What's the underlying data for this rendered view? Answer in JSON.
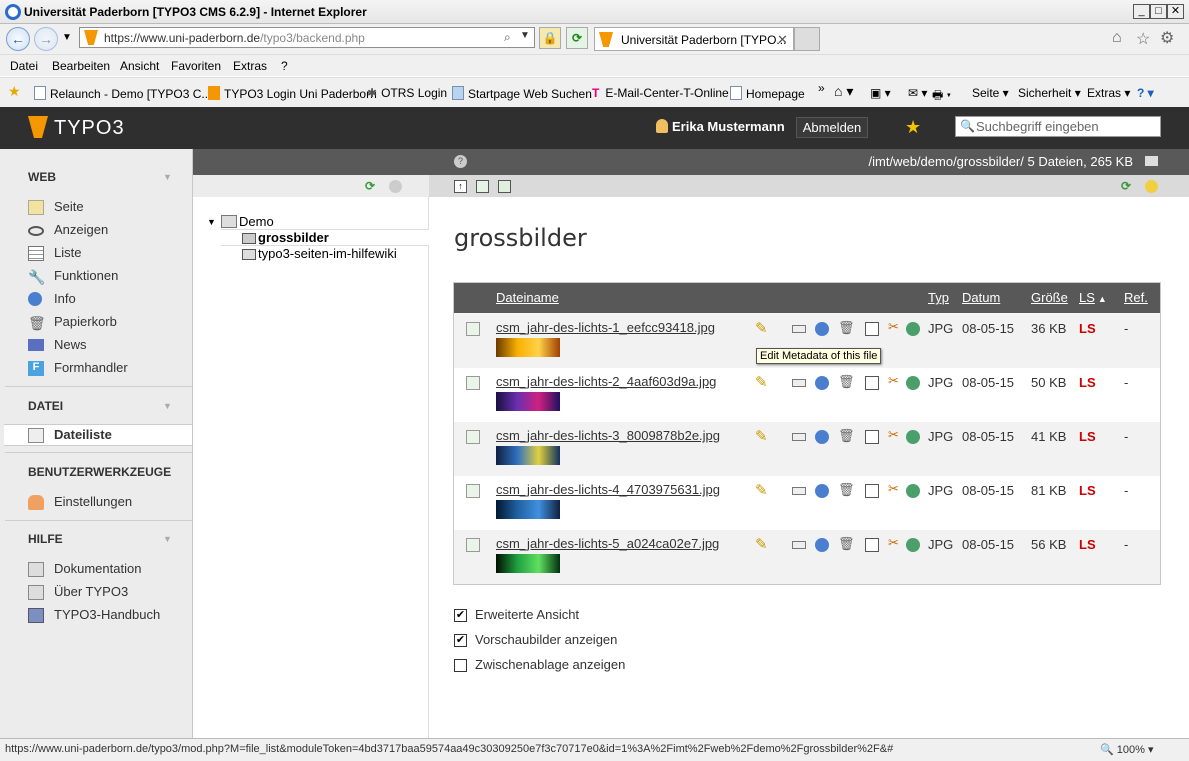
{
  "window": {
    "title": "Universität Paderborn [TYPO3 CMS 6.2.9] - Internet Explorer"
  },
  "browser": {
    "url_prefix": "https://www.",
    "url_domain": "uni-paderborn.de",
    "url_rest": "/typo3/backend.php",
    "tab_title": "Universität Paderborn [TYPO...",
    "menu": [
      "Datei",
      "Bearbeiten",
      "Ansicht",
      "Favoriten",
      "Extras",
      "?"
    ],
    "favorites": [
      "Relaunch - Demo [TYPO3 C...",
      "TYPO3 Login Uni Paderborn",
      "OTRS  Login",
      "Startpage Web Suchen",
      "E-Mail-Center-T-Online",
      "Homepage"
    ],
    "toolbar_right": [
      "Seite ▾",
      "Sicherheit ▾",
      "Extras ▾"
    ]
  },
  "typo3": {
    "logo_text": "TYPO3",
    "user_name": "Erika Mustermann",
    "logout_label": "Abmelden",
    "search_placeholder": "Suchbegriff eingeben"
  },
  "modules": {
    "web": {
      "title": "WEB",
      "items": [
        "Seite",
        "Anzeigen",
        "Liste",
        "Funktionen",
        "Info",
        "Papierkorb",
        "News",
        "Formhandler"
      ]
    },
    "datei": {
      "title": "DATEI",
      "items": [
        "Dateiliste"
      ]
    },
    "benutzer": {
      "title": "BENUTZERWERKZEUGE",
      "items": [
        "Einstellungen"
      ]
    },
    "hilfe": {
      "title": "HILFE",
      "items": [
        "Dokumentation",
        "Über TYPO3",
        "TYPO3-Handbuch"
      ]
    }
  },
  "docheader": {
    "path_info": "/imt/web/demo/grossbilder/ 5 Dateien, 265 KB"
  },
  "tree": {
    "root": "Demo",
    "folders": [
      "grossbilder",
      "typo3-seiten-im-hilfewiki"
    ]
  },
  "main": {
    "heading": "grossbilder",
    "columns": {
      "filename": "Dateiname",
      "type": "Typ",
      "date": "Datum",
      "size": "Größe",
      "ls": "LS",
      "ref": "Ref."
    },
    "rows": [
      {
        "name": "csm_jahr-des-lichts-1_eefcc93418.jpg",
        "type": "JPG",
        "date": "08-05-15",
        "size": "36 KB",
        "ls": "LS",
        "ref": "-"
      },
      {
        "name": "csm_jahr-des-lichts-2_4aaf603d9a.jpg",
        "type": "JPG",
        "date": "08-05-15",
        "size": "50 KB",
        "ls": "LS",
        "ref": "-"
      },
      {
        "name": "csm_jahr-des-lichts-3_8009878b2e.jpg",
        "type": "JPG",
        "date": "08-05-15",
        "size": "41 KB",
        "ls": "LS",
        "ref": "-"
      },
      {
        "name": "csm_jahr-des-lichts-4_4703975631.jpg",
        "type": "JPG",
        "date": "08-05-15",
        "size": "81 KB",
        "ls": "LS",
        "ref": "-"
      },
      {
        "name": "csm_jahr-des-lichts-5_a024ca02e7.jpg",
        "type": "JPG",
        "date": "08-05-15",
        "size": "56 KB",
        "ls": "LS",
        "ref": "-"
      }
    ],
    "tooltip": "Edit Metadata of this file",
    "options": [
      {
        "label": "Erweiterte Ansicht",
        "checked": true
      },
      {
        "label": "Vorschaubilder anzeigen",
        "checked": true
      },
      {
        "label": "Zwischenablage anzeigen",
        "checked": false
      }
    ]
  },
  "statusbar": {
    "url": "https://www.uni-paderborn.de/typo3/mod.php?M=file_list&moduleToken=4bd3717baa59574aa49c30309250e7f3c70717e0&id=1%3A%2Fimt%2Fweb%2Fdemo%2Fgrossbilder%2F&#",
    "zoom": "100%"
  }
}
